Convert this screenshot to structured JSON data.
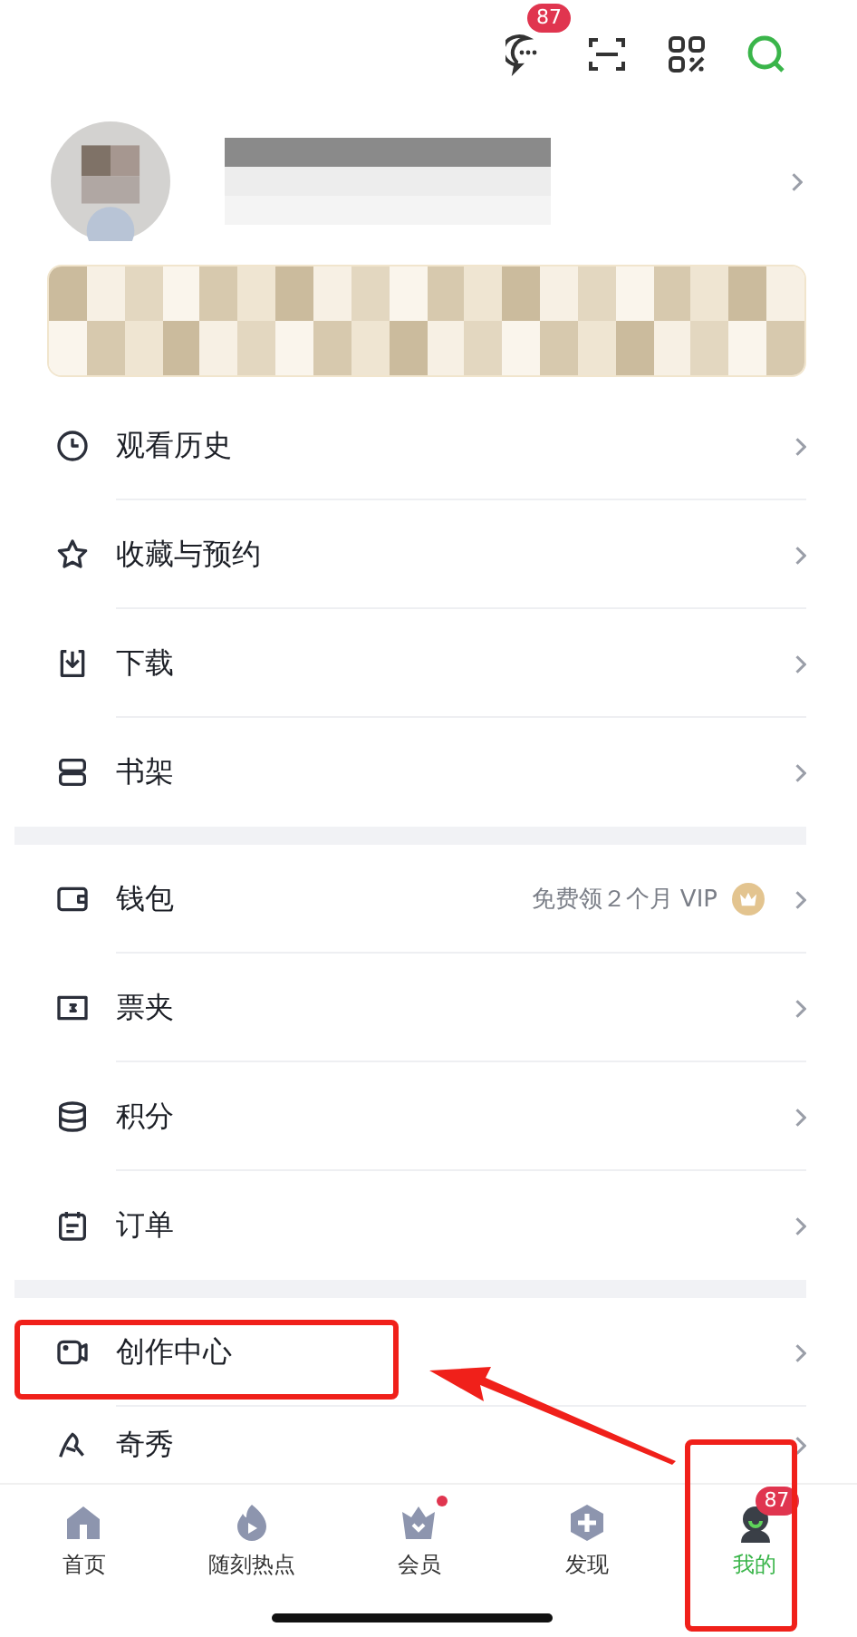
{
  "top_bar": {
    "message_badge": "87"
  },
  "menu_groups": [
    [
      {
        "label": "观看历史",
        "highlighted": false
      },
      {
        "label": "收藏与预约",
        "highlighted": false
      },
      {
        "label": "下载",
        "highlighted": false
      },
      {
        "label": "书架",
        "highlighted": false
      }
    ],
    [
      {
        "label": "钱包",
        "promo": "免费领２个月 VIP",
        "highlighted": false
      },
      {
        "label": "票夹",
        "highlighted": false
      },
      {
        "label": "积分",
        "highlighted": false
      },
      {
        "label": "订单",
        "highlighted": false
      }
    ],
    [
      {
        "label": "创作中心",
        "highlighted": true
      },
      {
        "label": "奇秀",
        "highlighted": false
      }
    ]
  ],
  "tab_bar": [
    {
      "label": "首页",
      "selected": false,
      "dot": false,
      "highlighted": false
    },
    {
      "label": "随刻热点",
      "selected": false,
      "dot": false,
      "highlighted": false
    },
    {
      "label": "会员",
      "selected": false,
      "dot": true,
      "highlighted": false
    },
    {
      "label": "发现",
      "selected": false,
      "dot": false,
      "highlighted": false
    },
    {
      "label": "我的",
      "selected": true,
      "dot": false,
      "badge": "87",
      "highlighted": true
    }
  ]
}
